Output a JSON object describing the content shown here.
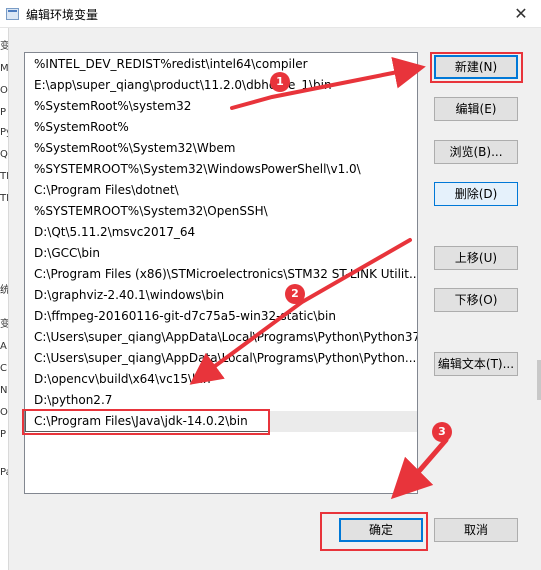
{
  "window": {
    "title": "编辑环境变量",
    "close_glyph": "✕"
  },
  "background": {
    "fragments": [
      "变",
      "M",
      "O",
      "P",
      "Py",
      "Q",
      "TE",
      "TM",
      "统",
      "变",
      "A",
      "C",
      "N",
      "O",
      "P",
      "Pa"
    ]
  },
  "paths": [
    "%INTEL_DEV_REDIST%redist\\intel64\\compiler",
    "E:\\app\\super_qiang\\product\\11.2.0\\dbhome_1\\bin",
    "%SystemRoot%\\system32",
    "%SystemRoot%",
    "%SystemRoot%\\System32\\Wbem",
    "%SYSTEMROOT%\\System32\\WindowsPowerShell\\v1.0\\",
    "C:\\Program Files\\dotnet\\",
    "%SYSTEMROOT%\\System32\\OpenSSH\\",
    "D:\\Qt\\5.11.2\\msvc2017_64",
    "D:\\GCC\\bin",
    "C:\\Program Files (x86)\\STMicroelectronics\\STM32 ST-LINK Utilit...",
    "D:\\graphviz-2.40.1\\windows\\bin",
    "D:\\ffmpeg-20160116-git-d7c75a5-win32-static\\bin",
    "C:\\Users\\super_qiang\\AppData\\Local\\Programs\\Python\\Python37",
    "C:\\Users\\super_qiang\\AppData\\Local\\Programs\\Python\\Python...",
    "D:\\opencv\\build\\x64\\vc15\\bin",
    "D:\\python2.7",
    "C:\\Program Files\\Java\\jdk-14.0.2\\bin"
  ],
  "selected_index": 17,
  "buttons": {
    "new": "新建(N)",
    "edit": "编辑(E)",
    "browse": "浏览(B)...",
    "delete": "删除(D)",
    "move_up": "上移(U)",
    "move_down": "下移(O)",
    "edit_text": "编辑文本(T)...",
    "ok": "确定",
    "cancel": "取消"
  },
  "annotations": {
    "badges": [
      "1",
      "2",
      "3"
    ],
    "color": "#e8343b"
  }
}
